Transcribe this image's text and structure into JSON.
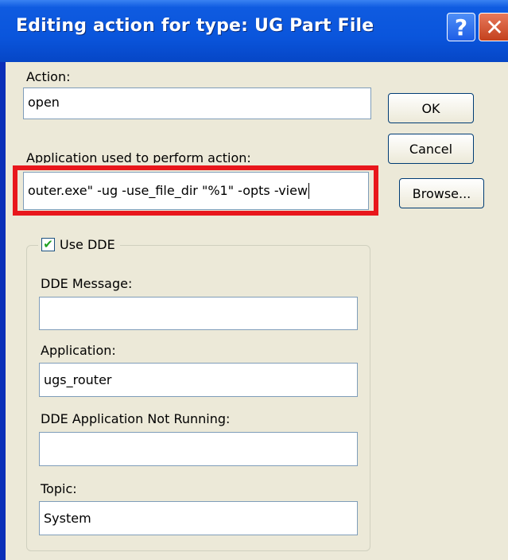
{
  "window": {
    "title": "Editing action for type: UG Part File",
    "help_label": "?",
    "close_label": "✕"
  },
  "action": {
    "label": "Action:",
    "value": "open"
  },
  "application_used": {
    "label": "Application used to perform action:",
    "value": "outer.exe\"  -ug -use_file_dir  \"%1\" -opts -view"
  },
  "buttons": {
    "ok": "OK",
    "cancel": "Cancel",
    "browse": "Browse..."
  },
  "dde": {
    "checkbox_label": "Use DDE",
    "checked": true,
    "message_label": "DDE Message:",
    "message_value": "",
    "application_label": "Application:",
    "application_value": "ugs_router",
    "not_running_label": "DDE Application Not Running:",
    "not_running_value": "",
    "topic_label": "Topic:",
    "topic_value": "System"
  },
  "colors": {
    "titlebar": "#0a55dc",
    "highlight": "#e8171c",
    "dialog_bg": "#ece9d8"
  }
}
